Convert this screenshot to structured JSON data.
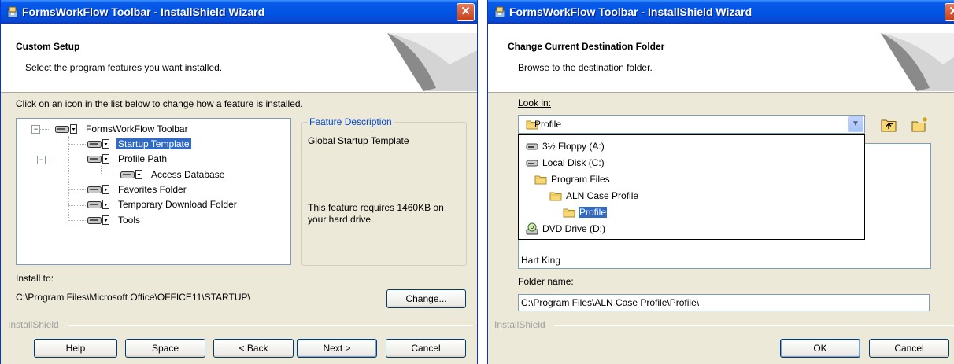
{
  "left_window": {
    "title": "FormsWorkFlow Toolbar - InstallShield Wizard",
    "header_title": "Custom Setup",
    "header_subtitle": "Select the program features you want installed.",
    "instruction": "Click on an icon in the list below to change how a feature is installed.",
    "features": [
      {
        "label": "FormsWorkFlow Toolbar"
      },
      {
        "label": "Startup Template",
        "selected": true
      },
      {
        "label": "Profile Path"
      },
      {
        "label": "Access Database"
      },
      {
        "label": "Favorites Folder"
      },
      {
        "label": "Temporary Download Folder"
      },
      {
        "label": "Tools"
      }
    ],
    "feature_description_legend": "Feature Description",
    "feature_description": "Global Startup Template",
    "feature_requirement": "This feature requires 1460KB on your hard drive.",
    "install_to_label": "Install to:",
    "install_path": "C:\\Program Files\\Microsoft Office\\OFFICE11\\STARTUP\\",
    "change_button": "Change...",
    "installshield_label": "InstallShield",
    "buttons": {
      "help": "Help",
      "space": "Space",
      "back": "< Back",
      "next": "Next >",
      "cancel": "Cancel"
    }
  },
  "right_window": {
    "title": "FormsWorkFlow Toolbar - InstallShield Wizard",
    "header_title": "Change Current Destination Folder",
    "header_subtitle": "Browse to the destination folder.",
    "look_in_label": "Look in:",
    "look_in_value": "Profile",
    "dropdown_items": [
      {
        "label": "3½ Floppy (A:)",
        "icon": "floppy-drive-icon"
      },
      {
        "label": "Local Disk (C:)",
        "icon": "hard-disk-icon"
      },
      {
        "label": "Program Files",
        "icon": "folder-icon"
      },
      {
        "label": "ALN Case Profile",
        "icon": "folder-icon"
      },
      {
        "label": "Profile",
        "icon": "folder-icon",
        "selected": true
      },
      {
        "label": "DVD Drive (D:)",
        "icon": "dvd-drive-icon"
      }
    ],
    "list_partial_item": "Hart King",
    "folder_name_label": "Folder name:",
    "folder_name_value": "C:\\Program Files\\ALN Case Profile\\Profile\\",
    "installshield_label": "InstallShield",
    "buttons": {
      "ok": "OK",
      "cancel": "Cancel"
    }
  },
  "colors": {
    "title_bar": "#0054e3",
    "dialog_bg": "#ece9d8",
    "selection": "#316ac5",
    "legend_text": "#0046d5"
  }
}
